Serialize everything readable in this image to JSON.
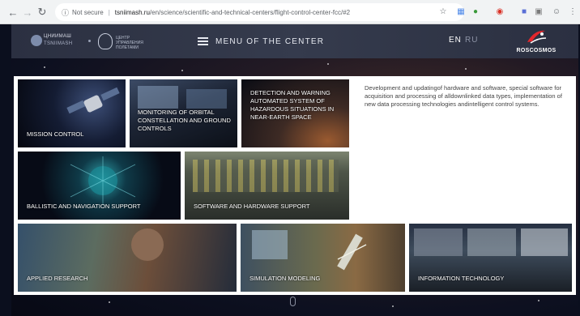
{
  "browser": {
    "security_label": "Not secure",
    "url_host": "tsniimash.ru",
    "url_path": "/en/science/scientific-and-technical-centers/flight-control-center-fcc/#2"
  },
  "header": {
    "logo1_line1": "ЦНИИМАШ",
    "logo1_line2": "TSNIIMASH",
    "logo2_text": "ЦЕНТР УПРАВЛЕНИЯ ПОЛЕТАМИ",
    "menu_label": "MENU OF THE CENTER",
    "lang_en": "EN",
    "lang_ru": "RU",
    "roscosmos_label": "ROSCOSMOS"
  },
  "tiles": [
    {
      "id": "mission-control",
      "label": "MISSION CONTROL"
    },
    {
      "id": "monitoring",
      "label": "MONITORING OF ORBITAL CONSTELLATION AND GROUND CONTROLS"
    },
    {
      "id": "detection",
      "label": "DETECTION AND WARNING AUTOMATED SYSTEM OF HAZARDOUS SITUATIONS IN NEAR-EARTH SPACE"
    },
    {
      "id": "ballistic",
      "label": "BALLISTIC AND NAVIGATION SUPPORT"
    },
    {
      "id": "software",
      "label": "SOFTWARE AND HARDWARE SUPPORT"
    },
    {
      "id": "applied",
      "label": "APPLIED RESEARCH"
    },
    {
      "id": "simulation",
      "label": "SIMULATION MODELING"
    },
    {
      "id": "it",
      "label": "INFORMATION TECHNOLOGY"
    }
  ],
  "description": "Development and updatingof hardware and software, special software for acquisition and processing of alldownlinked data types, implementation of new data processing technologies andintelligent control systems.",
  "icons": {
    "back": "back-arrow-icon",
    "forward": "forward-arrow-icon",
    "reload": "reload-icon",
    "info": "info-icon",
    "star": "star-icon",
    "menu": "hamburger-icon",
    "profile": "profile-icon"
  },
  "colors": {
    "header_bg": "#2b3041",
    "roscosmos_red": "#e3262c",
    "panel_bg": "#ffffff"
  }
}
